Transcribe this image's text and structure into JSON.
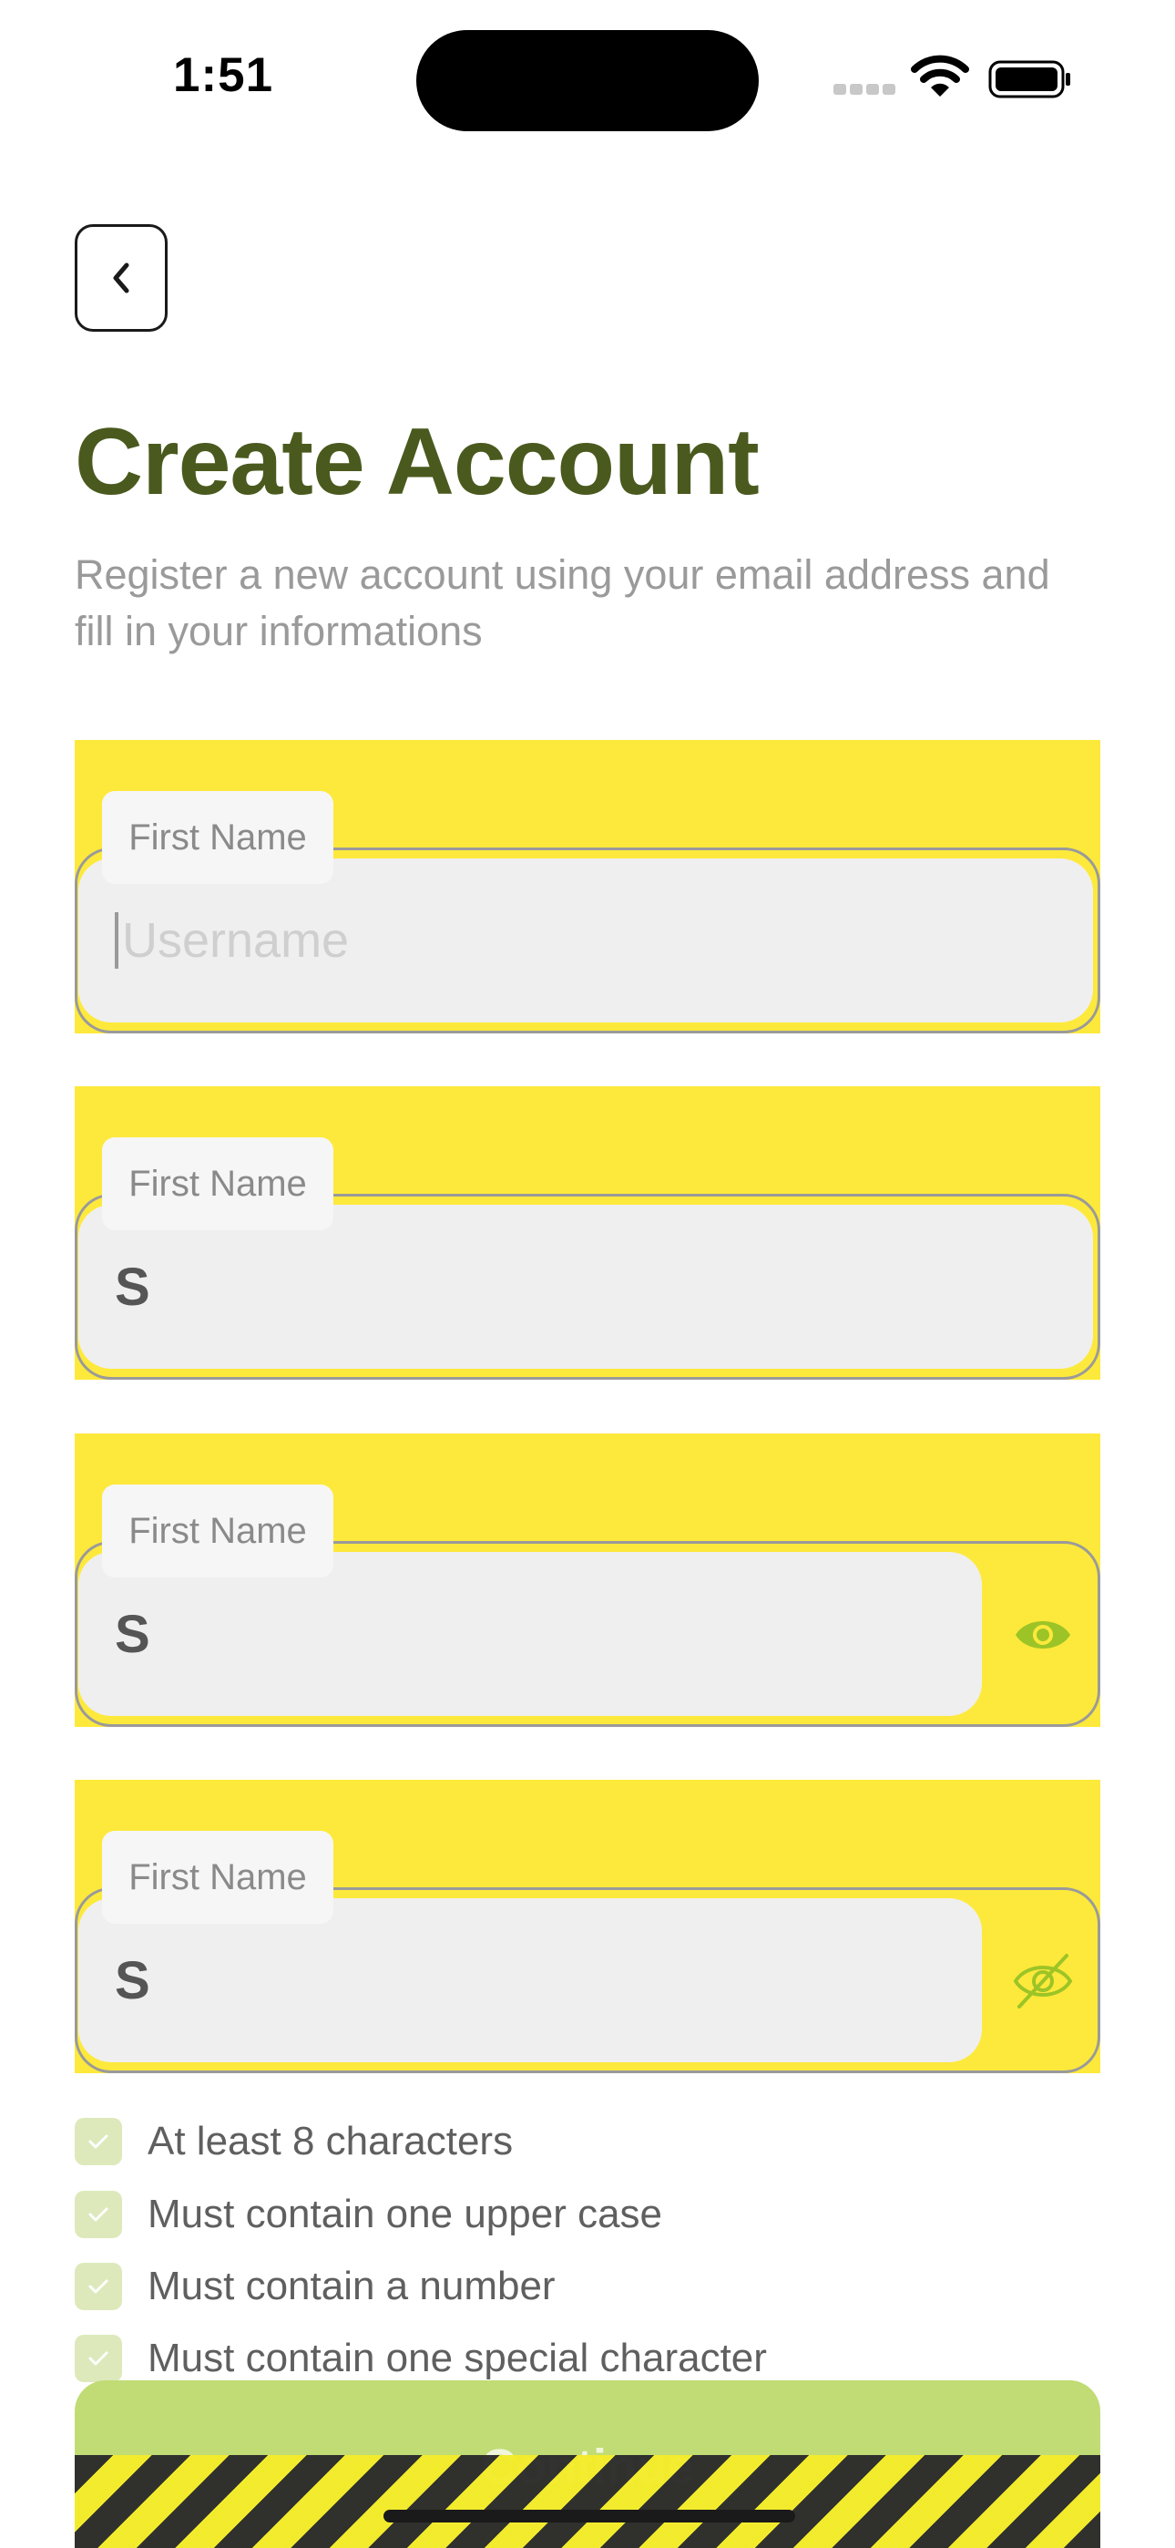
{
  "status_bar": {
    "time": "1:51"
  },
  "header": {
    "title": "Create Account",
    "subtitle": "Register a new account using your email address and fill in your informations"
  },
  "fields": [
    {
      "label": "First Name",
      "placeholder": "Username",
      "value": ""
    },
    {
      "label": "First Name",
      "value": "S"
    },
    {
      "label": "First Name",
      "value": "S",
      "toggle_icon": "eye-icon"
    },
    {
      "label": "First Name",
      "value": "S",
      "toggle_icon": "eye-off-icon"
    }
  ],
  "requirements": [
    "At least 8 characters",
    "Must contain one upper case",
    "Must contain a number",
    "Must contain one special character"
  ],
  "continue_label": "Continue",
  "colors": {
    "title": "#4a5a1e",
    "field_highlight": "#fde93b",
    "accent_green": "#9cc427",
    "check_bg": "#dde9bb",
    "continue_bg": "#c1dc74"
  }
}
